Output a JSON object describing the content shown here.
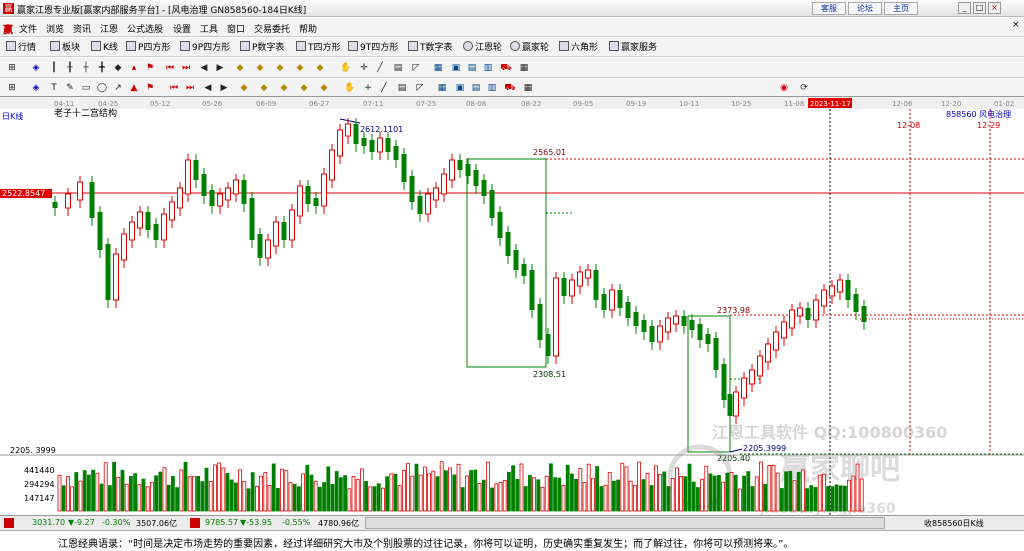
{
  "window": {
    "logo": "赢",
    "title": "赢家江恩专业版[赢家内部服务平台] - [风电治理  GN858560-184日K线]",
    "links": [
      "客服",
      "论坛",
      "主页"
    ],
    "controls": [
      "_",
      "□",
      "×"
    ]
  },
  "menu": {
    "logo": "赢",
    "items": [
      "文件",
      "浏览",
      "资讯",
      "江恩",
      "公式选股",
      "设置",
      "工具",
      "窗口",
      "交易委托",
      "帮助"
    ]
  },
  "toolbar": {
    "items": [
      "行情",
      "板块",
      "K线",
      "P四方形",
      "9P四方形",
      "P数字表",
      "T四方形",
      "9T四方形",
      "T数字表",
      "江恩轮",
      "赢家轮",
      "六角形",
      "赢家服务"
    ]
  },
  "chart": {
    "tab_label": "日K线",
    "indicator_name": "老子十二宫结构",
    "symbol_info": "858560  风电治理",
    "current_price_tag": "2522.8547",
    "volume_scale_label": "2205. 3999",
    "date_labels": [
      "04-11",
      "04-25",
      "05-12",
      "05-26",
      "06-09",
      "06-27",
      "07-11",
      "07-25",
      "08-08",
      "08-22",
      "09-05",
      "09-19",
      "10-11",
      "10-25",
      "11-08",
      "2023-11-17",
      "12-06",
      "12-20",
      "01-02"
    ],
    "highlight_date": "2023-11-17",
    "future_dates": [
      "12-08",
      "12-29"
    ],
    "price_labels": {
      "high": "2612.1101",
      "box1_top": "2565.01",
      "box1_bottom": "2308.51",
      "box2_top": "2373.98",
      "box2_bottom": "2205.40",
      "low": "2205.3999"
    },
    "volume_axis": [
      "441440",
      "294294",
      "147147"
    ],
    "watermark_lines": [
      "江恩工具软件  QQ:100800360",
      "赢家聊吧",
      "jiaoba.yingjia360"
    ],
    "colors": {
      "up": "#e00000",
      "down": "#008000",
      "box": "#008000",
      "price_line": "#e00000"
    }
  },
  "status": {
    "index1": "3031.70",
    "index1_change": "▼-9.27",
    "index1_pct": "-0.30%",
    "index1_amount": "3507.06亿",
    "index2": "9785.57",
    "index2_change": "▼-53.95",
    "index2_pct": "-0.55%",
    "index2_amount": "4780.96亿",
    "right_label": "收858560日K线"
  },
  "quote": {
    "text": "江恩经典语录：“时间是决定市场走势的重要因素，经过详细研究大市及个别股票的过往记录，你将可以证明，历史确实重复发生；而了解过往，你将可以预测将来。”。"
  }
}
